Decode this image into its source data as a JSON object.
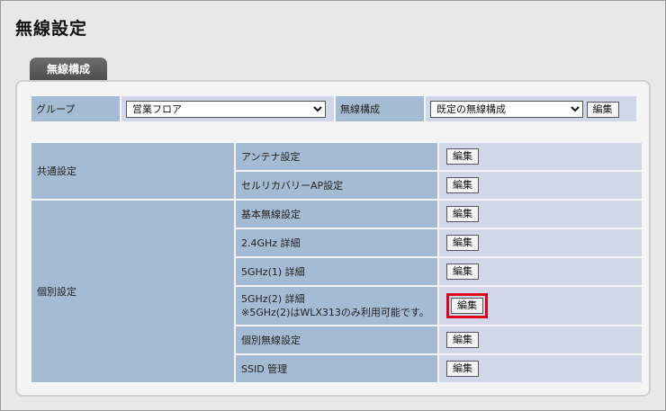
{
  "page": {
    "title": "無線設定"
  },
  "tab": {
    "label": "無線構成"
  },
  "group_row": {
    "group_label": "グループ",
    "group_value": "営業フロア",
    "config_label": "無線構成",
    "config_value": "既定の無線構成",
    "edit_label": "編集"
  },
  "sections": {
    "common": {
      "label": "共通設定",
      "items": [
        {
          "label": "アンテナ設定",
          "edit": "編集"
        },
        {
          "label": "セルリカバリーAP設定",
          "edit": "編集"
        }
      ]
    },
    "individual": {
      "label": "個別設定",
      "items": [
        {
          "label": "基本無線設定",
          "edit": "編集"
        },
        {
          "label": "2.4GHz 詳細",
          "edit": "編集"
        },
        {
          "label": "5GHz(1) 詳細",
          "edit": "編集"
        },
        {
          "label": "5GHz(2) 詳細",
          "note": "※5GHz(2)はWLX313のみ利用可能です。",
          "edit": "編集"
        },
        {
          "label": "個別無線設定",
          "edit": "編集"
        },
        {
          "label": "SSID 管理",
          "edit": "編集"
        }
      ]
    }
  },
  "colors": {
    "highlight": "#e0001a",
    "label_bg": "#a5bbd4",
    "value_bg": "#cfd7e8"
  }
}
